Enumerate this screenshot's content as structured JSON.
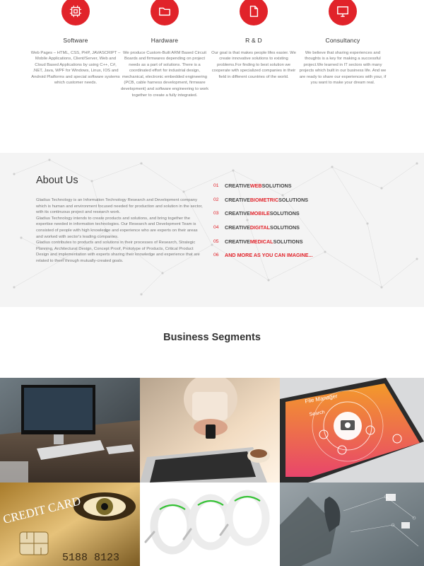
{
  "services": [
    {
      "icon": "chip-icon",
      "title": "Software",
      "text": "Web Pages – HTML, CSS, PHP, JAVASCRIPT – Mobile Applications, Client/Server, Web and Cloud Based Applications by using C++, C#, .NET, Java, WPF for Windows, Linux, IOS and Android Platforms and special software systems which customer needs."
    },
    {
      "icon": "folder-icon",
      "title": "Hardware",
      "text": "We produce Custom-Built ARM Based Circuit Boards and firmwares depending on project needs as a part of solutions.  There is a coordinated effort for industrial design, mechanical, electronic embedded engineering (PCB, cable harness development, firmware development) and software engineering to work together to create a fully integrated."
    },
    {
      "icon": "document-icon",
      "title": "R & D",
      "text": "Our goal is that makes people lifes easier. We create innovative solutions to existing problems.For finding to best solution we cooperate with specialized companies in their field in different countries of the world."
    },
    {
      "icon": "monitor-icon",
      "title": "Consultancy",
      "text": "We believe that sharing experiences and thoughts is a key for making a successful project.We learned in IT sectors with many projects which built in our business life. And we are ready to share our experiences with your, if you want to make your dream real."
    }
  ],
  "about": {
    "title": "About Us",
    "paragraphs": [
      "Gladius Technology is an Information Technology Research and Development company which is human and environment focused needed for production and solution in the sector, with its continuous project and research work.",
      "Gladius Technology intends to create products and solutions, and bring together the expertise needed in information technologies. Our Research and Development Team is consisted of people with high knowledge and experience who are experts on their areas and worked with sector's leading companies.",
      "Gladius contributes to products and solutions in their processes of Research, Strategic Planning, Architectural Design, Concept Proof, Prototype of Products, Critical Product Design and implementation with experts sharing their knowledge and experience that are related to them through mutually-created goals."
    ],
    "list": [
      {
        "num": "01",
        "pre": "CREATIVE ",
        "hl": "WEB",
        "post": " SOLUTIONS"
      },
      {
        "num": "02",
        "pre": "CREATIVE ",
        "hl": "BIOMETRIC",
        "post": " SOLUTIONS"
      },
      {
        "num": "03",
        "pre": "CREATIVE ",
        "hl": "MOBILE",
        "post": " SOLUTIONS"
      },
      {
        "num": "04",
        "pre": "CREATIVE ",
        "hl": "DIGITAL",
        "post": " SOLUTIONS"
      },
      {
        "num": "05",
        "pre": "CREATIVE ",
        "hl": "MEDICAL",
        "post": " SOLUTIONS"
      },
      {
        "num": "06",
        "pre": "",
        "hl": "",
        "post": "AND MORE AS YOU CAN IMAGINE..."
      }
    ]
  },
  "segments": {
    "title": "Business Segments",
    "search_label": "Search",
    "app_title": "File Manager",
    "card_text": "CREDIT CARD",
    "card_digits": "5188 8123"
  },
  "colors": {
    "accent": "#e1232a"
  }
}
